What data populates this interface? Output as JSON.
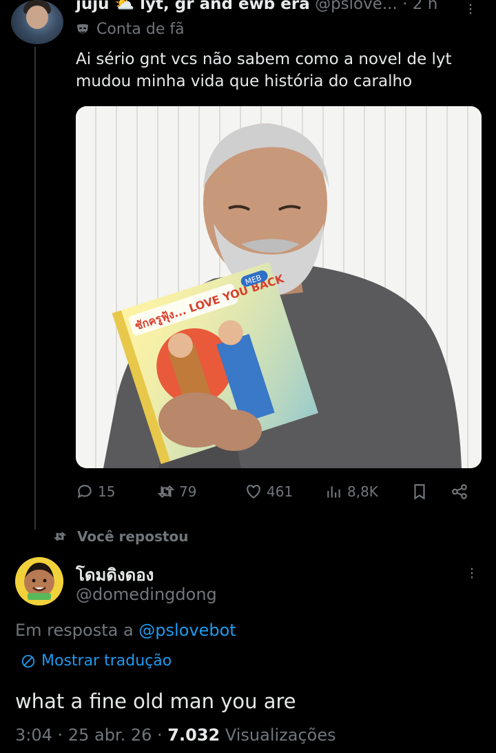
{
  "tweet1": {
    "display_name": "juju ⛅ lyt, gr and ewb era",
    "handle": "@pslove...",
    "time": "· 2 h",
    "badge": "Conta de fã",
    "text": "Ai sério gnt vcs não sabem como a novel de lyt mudou minha vida que história do caralho",
    "image": {
      "book_title": "ชักครูฟุ้ง... LOVE YOU BACK",
      "book_subtitle": "LOVE YOU BACK",
      "book_badge": "MEB"
    },
    "stats": {
      "replies": "15",
      "reposts": "79",
      "likes": "461",
      "views": "8,8K"
    }
  },
  "repost_label": "Você repostou",
  "tweet2": {
    "display_name": "โดมดิงดอง",
    "handle": "@domedingdong",
    "reply_prefix": "Em resposta a",
    "reply_to": "@pslovebot",
    "translate_label": "Mostrar tradução",
    "text": "what a fine old man you are",
    "time": "3:04",
    "date": "25 abr. 26",
    "views_count": "7.032",
    "views_label": "Visualizações"
  },
  "colors": {
    "background": "#000000",
    "text": "#e7e9ea",
    "muted": "#71767b",
    "accent": "#1d9bf0"
  }
}
